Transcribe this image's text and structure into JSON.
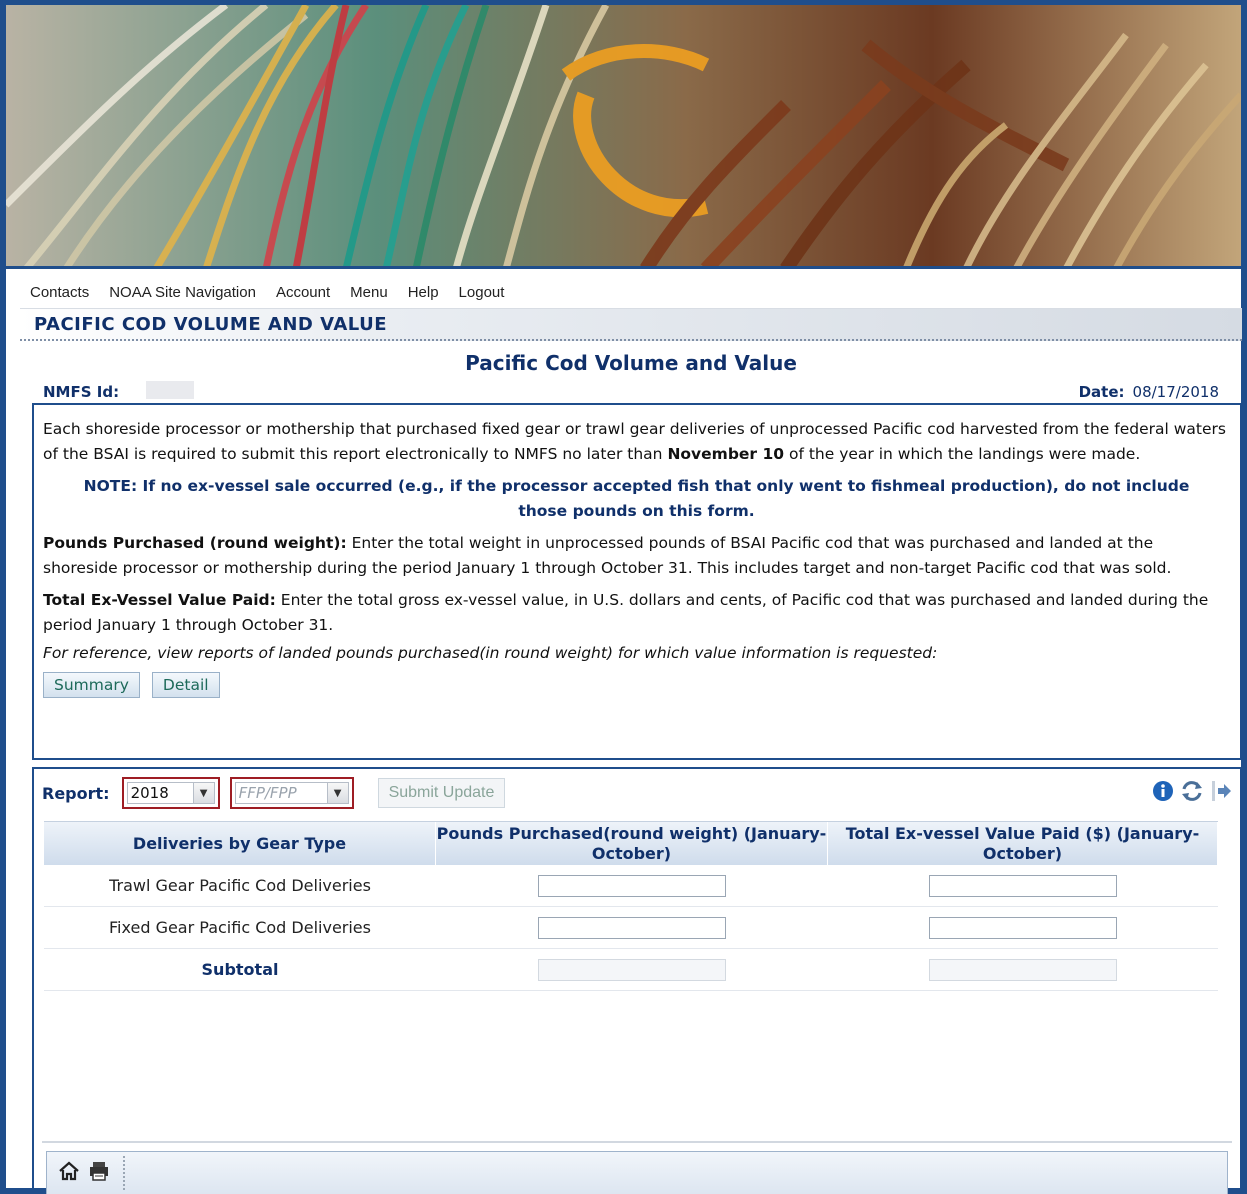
{
  "nav": {
    "items": [
      "Contacts",
      "NOAA Site Navigation",
      "Account",
      "Menu",
      "Help",
      "Logout"
    ]
  },
  "section_title": "PACIFIC COD VOLUME AND VALUE",
  "form": {
    "title": "Pacific Cod Volume and Value",
    "nmfs_label": "NMFS Id:",
    "date_label": "Date:",
    "date_value": "08/17/2018"
  },
  "instructions": {
    "intro_pre": "Each shoreside processor or mothership that purchased fixed gear or trawl gear deliveries of unprocessed Pacific cod harvested from the federal waters of the BSAI is required to submit this report electronically to NMFS no later than ",
    "intro_bold": "November 10",
    "intro_post": " of the year in which the landings were made.",
    "note": "NOTE: If no ex-vessel sale occurred (e.g., if the processor accepted fish that only went to fishmeal production), do not include those pounds on this form.",
    "pounds_label": "Pounds Purchased (round weight):",
    "pounds_text": " Enter the total weight in unprocessed pounds of BSAI Pacific cod that was purchased and landed at the shoreside processor or mothership during the period January 1 through October 31. This includes target and non-target Pacific cod that was sold.",
    "value_label": "Total Ex-Vessel Value Paid:",
    "value_text": " Enter the total gross ex-vessel value, in U.S. dollars and cents, of Pacific cod that was purchased and landed during the period January 1 through October 31.",
    "reference": "For reference, view reports of landed pounds purchased(in round weight) for which value information is requested:",
    "summary_button": "Summary",
    "detail_button": "Detail"
  },
  "report": {
    "label": "Report:",
    "year_value": "2018",
    "permit_placeholder": "FFP/FPP",
    "submit_label": "Submit Update",
    "icons": [
      "info-icon",
      "refresh-icon",
      "export-icon"
    ]
  },
  "grid": {
    "headers": [
      "Deliveries by Gear Type",
      "Pounds Purchased(round weight) (January-October)",
      "Total Ex-vessel Value Paid ($) (January-October)"
    ],
    "rows": [
      {
        "label": "Trawl Gear Pacific Cod Deliveries",
        "pounds": "",
        "value": ""
      },
      {
        "label": "Fixed Gear Pacific Cod Deliveries",
        "pounds": "",
        "value": ""
      },
      {
        "label": "Subtotal",
        "pounds": "",
        "value": ""
      }
    ]
  },
  "footer": {
    "icons": [
      "home-icon",
      "print-icon"
    ]
  },
  "colors": {
    "frame": "#1f4e8c",
    "heading": "#10306a",
    "select_border": "#9e1d24",
    "button_text": "#1e6a5a"
  }
}
